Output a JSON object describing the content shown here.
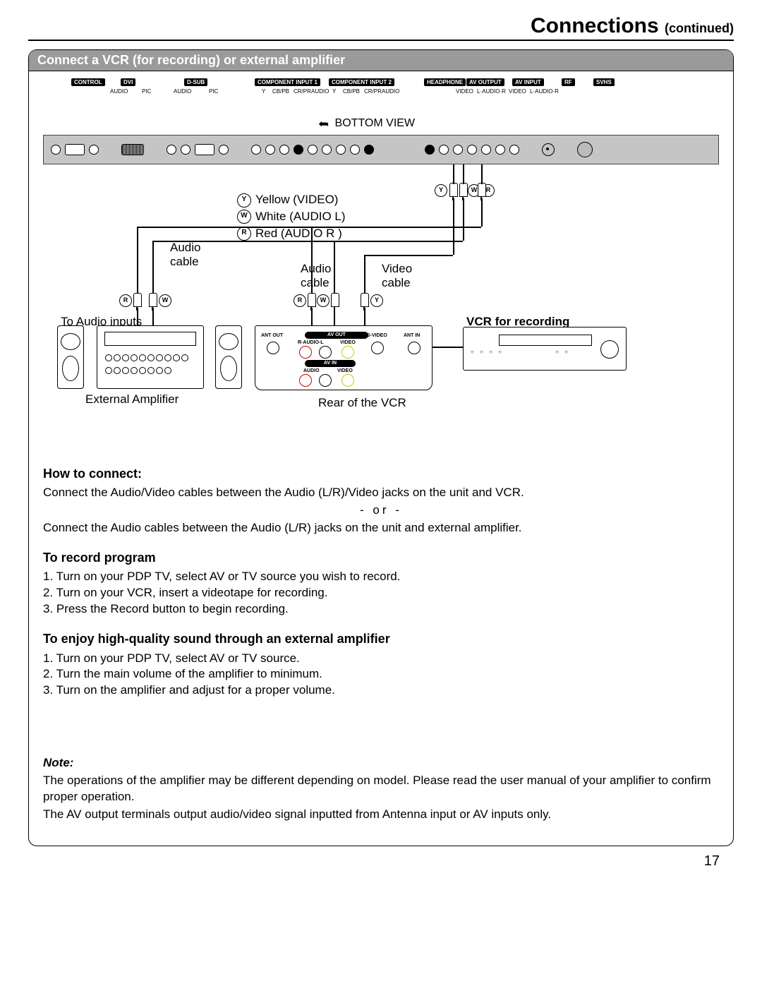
{
  "header": {
    "title": "Connections",
    "subtitle": "(continued)"
  },
  "section_title": "Connect a VCR (for recording) or external amplifier",
  "top_port_labels": {
    "control": "CONTROL",
    "dvi": "DVI",
    "dsub": "D-SUB",
    "comp1": "COMPONENT INPUT 1",
    "comp2": "COMPONENT INPUT 2",
    "headphone": "HEADPHONE",
    "av_output": "AV OUTPUT",
    "av_input": "AV INPUT",
    "rf": "RF",
    "svhs": "SVHS",
    "audio": "AUDIO",
    "pic": "PIC",
    "y": "Y",
    "cbpb": "CB/PB",
    "crpr": "CR/PR",
    "video": "VIDEO",
    "l_audio_r": "L·AUDIO·R"
  },
  "diagram": {
    "bottom_view": "BOTTOM VIEW",
    "legend": {
      "yellow": "Yellow (VIDEO)",
      "white": "White (AUDIO L)",
      "red": "Red (AUDIO R )"
    },
    "ywr_short": {
      "y": "Y",
      "w": "W",
      "r": "R"
    },
    "labels": {
      "audio_cable_left": "Audio\ncable",
      "audio_cable_mid": "Audio\ncable",
      "video_cable": "Video\ncable",
      "to_audio_inputs": "To Audio inputs",
      "vcr_for_recording": "VCR for recording",
      "external_amplifier": "External Amplifier",
      "rear_of_vcr": "Rear of the VCR"
    },
    "vcr_rear": {
      "ant_out": "ANT OUT",
      "ant_in": "ANT IN",
      "av_out": "AV OUT",
      "av_in": "AV IN",
      "s_video": "S-VIDEO",
      "r_audio_l": "R-AUDIO-L",
      "video": "VIDEO",
      "audio": "AUDIO"
    }
  },
  "instructions": {
    "how_to_connect_h": "How to connect:",
    "how_line1": "Connect the Audio/Video cables between the Audio (L/R)/Video jacks on the unit and VCR.",
    "or": "- or -",
    "how_line2": "Connect the Audio cables between the Audio (L/R) jacks on the unit and external amplifier.",
    "record_h": "To record program",
    "record_steps": [
      "1. Turn on your PDP TV, select AV or TV source you wish to record.",
      "2. Turn on your VCR, insert a videotape for recording.",
      "3. Press the Record button to begin recording."
    ],
    "amp_h": "To enjoy high-quality sound through an external amplifier",
    "amp_steps": [
      "1. Turn on your PDP TV, select AV or TV source.",
      "2. Turn the main volume of the amplifier to minimum.",
      "3. Turn on the amplifier and adjust for a proper volume."
    ],
    "note_h": "Note:",
    "note_p1": "The operations of the amplifier may be different depending on model. Please read the user manual of your amplifier to confirm proper operation.",
    "note_p2": "The AV output terminals output audio/video signal inputted from Antenna input or AV inputs only."
  },
  "page_number": "17"
}
